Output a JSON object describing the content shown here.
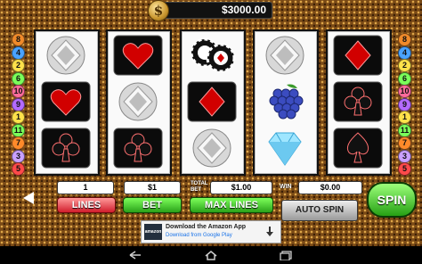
{
  "header": {
    "balance": "$3000.00",
    "coin_symbol": "$"
  },
  "paylines": {
    "left": [
      "8",
      "4",
      "2",
      "6",
      "10",
      "9",
      "1",
      "11",
      "7",
      "3",
      "5"
    ],
    "right": [
      "8",
      "4",
      "2",
      "6",
      "10",
      "9",
      "1",
      "11",
      "7",
      "3",
      "5"
    ]
  },
  "reels": [
    [
      "diamond-gem",
      "heart-card",
      "club-card"
    ],
    [
      "heart-card",
      "diamond-gem",
      "club-card"
    ],
    [
      "poker-chips",
      "diamond-card",
      "diamond-gem"
    ],
    [
      "diamond-gem",
      "grapes",
      "blue-diamond"
    ],
    [
      "diamond-card",
      "club-card",
      "spade-card"
    ]
  ],
  "controls": {
    "lines_value": "1",
    "bet_value": "$1",
    "total_bet_label": "TOTAL BET",
    "total_bet_value": "$1.00",
    "win_label": "WIN",
    "win_value": "$0.00",
    "lines_button": "LINES",
    "bet_button": "BET",
    "max_lines_button": "MAX LINES",
    "auto_spin_button": "AUTO SPIN",
    "spin_button": "SPIN"
  },
  "ad": {
    "brand": "amazon",
    "title": "Download the Amazon App",
    "subtitle": "Download from Google Play"
  },
  "colors": {
    "accent_green": "#2aa21a",
    "balance_bg": "#111111",
    "card_red": "#d10000"
  }
}
